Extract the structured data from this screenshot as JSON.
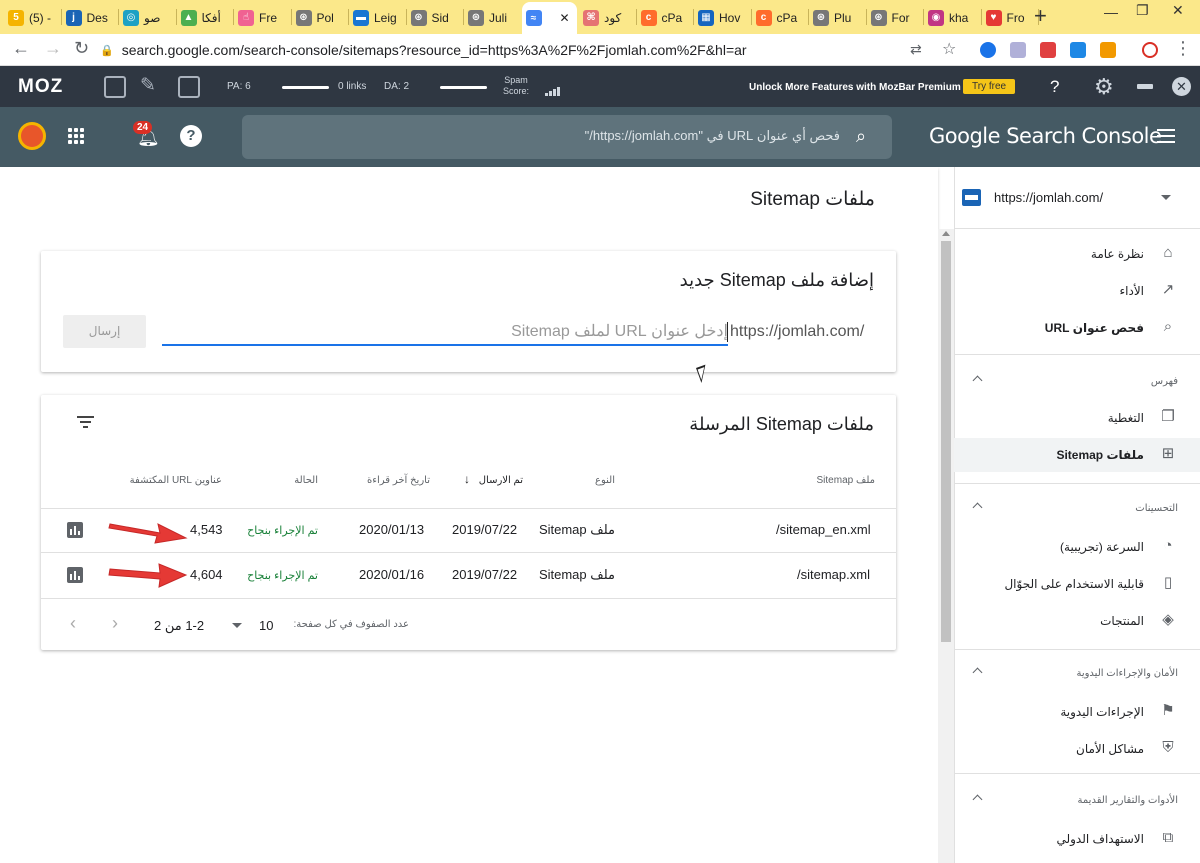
{
  "browser": {
    "tabs": [
      {
        "label": "(5) -",
        "fav": "5",
        "color": "#f5b400"
      },
      {
        "label": "Des",
        "fav": "j",
        "color": "#1a64b5"
      },
      {
        "label": "صو",
        "fav": "◎",
        "color": "#1da1c4"
      },
      {
        "label": "أفكا",
        "fav": "▲",
        "color": "#4caf50"
      },
      {
        "label": "Fre",
        "fav": "☝",
        "color": "#f06292"
      },
      {
        "label": "Pol",
        "fav": "⊛",
        "color": "#777"
      },
      {
        "label": "Leig",
        "fav": "▬",
        "color": "#1976d2"
      },
      {
        "label": "Sid",
        "fav": "⊛",
        "color": "#777"
      },
      {
        "label": "Juli",
        "fav": "⊛",
        "color": "#777"
      },
      {
        "label": "",
        "fav": "≈",
        "color": "#4285f4",
        "active": true
      },
      {
        "label": "كود",
        "fav": "⌘",
        "color": "#e57373"
      },
      {
        "label": "cPa",
        "fav": "c",
        "color": "#ff6c2c"
      },
      {
        "label": "Hov",
        "fav": "▦",
        "color": "#1565c0"
      },
      {
        "label": "cPa",
        "fav": "c",
        "color": "#ff6c2c"
      },
      {
        "label": "Plu",
        "fav": "⊛",
        "color": "#777"
      },
      {
        "label": "For",
        "fav": "⊛",
        "color": "#777"
      },
      {
        "label": "kha",
        "fav": "◉",
        "color": "#c13584"
      },
      {
        "label": "Fro",
        "fav": "♥",
        "color": "#e53935"
      }
    ],
    "close_tab": "✕",
    "new_tab": "+",
    "minimize": "—",
    "restore": "❐",
    "close_window": "✕",
    "url": "search.google.com/search-console/sitemaps?resource_id=https%3A%2F%2Fjomlah.com%2F&hl=ar"
  },
  "mozbar": {
    "logo": "MOZ",
    "pa": "PA: 6",
    "links": "0 links",
    "da": "DA: 2",
    "spam_label": "Spam",
    "spam_label2": "Score:",
    "promo": "Unlock More Features with MozBar Premium",
    "try_free": "Try free",
    "help": "?",
    "close": "✕"
  },
  "gsc": {
    "brand": "Google Search Console",
    "search_placeholder": "فحص أي عنوان URL في \"https://jomlah.com/\"",
    "notification_count": "24",
    "help": "?"
  },
  "page": {
    "title": "ملفات Sitemap"
  },
  "add_card": {
    "title": "إضافة ملف Sitemap جديد",
    "prefix": "https://jomlah.com/",
    "input_placeholder": "إدخل عنوان URL لملف Sitemap",
    "submit": "إرسال"
  },
  "submitted_card": {
    "title": "ملفات Sitemap المرسلة",
    "columns": {
      "sitemap": "ملف Sitemap",
      "type": "النوع",
      "submitted": "تم الارسال",
      "last_read": "تاريخ آخر قراءة",
      "status": "الحالة",
      "discovered": "عناوين URL المكتشفة"
    },
    "sort_arrow": "↓",
    "rows": [
      {
        "sitemap": "/sitemap_en.xml",
        "type": "ملف Sitemap",
        "submitted": "2019/07/22",
        "last_read": "2020/01/13",
        "status": "تم الإجراء بنجاح",
        "discovered": "4,543"
      },
      {
        "sitemap": "/sitemap.xml",
        "type": "ملف Sitemap",
        "submitted": "2019/07/22",
        "last_read": "2020/01/16",
        "status": "تم الإجراء بنجاح",
        "discovered": "4,604"
      }
    ],
    "pager": {
      "rows_label": "عدد الصفوف في كل صفحة:",
      "rows_value": "10",
      "range": "1-2 من 2",
      "prev": "‹",
      "next": "›"
    }
  },
  "sidebar": {
    "property": "https://jomlah.com/",
    "items": [
      {
        "label": "نظرة عامة",
        "icon": "⌂"
      },
      {
        "label": "الأداء",
        "icon": "↗"
      },
      {
        "label": "فحص عنوان URL",
        "icon": "⌕",
        "bold": true
      },
      {
        "label": "التغطية",
        "icon": "❐"
      },
      {
        "label": "ملفات Sitemap",
        "icon": "⊞",
        "bold": true,
        "selected": true
      },
      {
        "label": "السرعة (تجريبية)",
        "icon": "◔"
      },
      {
        "label": "قابلية الاستخدام على الجوّال",
        "icon": "▯"
      },
      {
        "label": "المنتجات",
        "icon": "◈"
      },
      {
        "label": "الإجراءات اليدوية",
        "icon": "⚑"
      },
      {
        "label": "مشاكل الأمان",
        "icon": "⛨"
      },
      {
        "label": "الاستهداف الدولي",
        "icon": "⧉"
      }
    ],
    "sections": [
      {
        "label": "فهرس"
      },
      {
        "label": "التحسينات"
      },
      {
        "label": "الأمان والإجراءات اليدوية"
      },
      {
        "label": "الأدوات والتقارير القديمة"
      }
    ]
  },
  "colors": {
    "tabstrip": "#fbe88a",
    "mozbar": "#2f3742",
    "gsc_header": "#455a64",
    "accent_blue": "#1a73e8",
    "success_green": "#188038",
    "arrow_red": "#e53935"
  }
}
